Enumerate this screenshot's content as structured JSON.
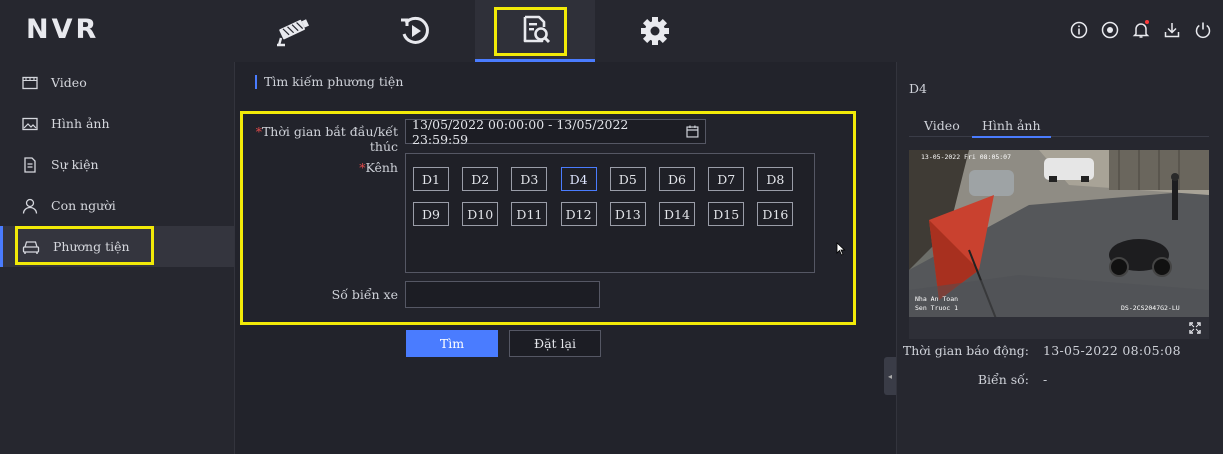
{
  "app": {
    "logo": "NVR"
  },
  "nav_tabs": [
    {
      "icon": "camera-icon"
    },
    {
      "icon": "playback-icon"
    },
    {
      "icon": "search-file-icon",
      "active": true
    },
    {
      "icon": "gear-icon"
    }
  ],
  "top_right_icons": [
    "info-icon",
    "record-icon",
    "bell-icon",
    "download-icon",
    "power-icon"
  ],
  "sidebar": {
    "items": [
      {
        "label": "Video",
        "icon": "video-icon"
      },
      {
        "label": "Hình ảnh",
        "icon": "image-icon"
      },
      {
        "label": "Sự kiện",
        "icon": "event-icon"
      },
      {
        "label": "Con người",
        "icon": "person-icon"
      },
      {
        "label": "Phương tiện",
        "icon": "car-icon",
        "active": true
      }
    ]
  },
  "main": {
    "breadcrumb": "Tìm kiếm phương tiện",
    "time_label": "Thời gian bắt đầu/kết thúc",
    "time_value": "13/05/2022 00:00:00 - 13/05/2022 23:59:59",
    "channel_label": "Kênh",
    "channels": [
      "D1",
      "D2",
      "D3",
      "D4",
      "D5",
      "D6",
      "D7",
      "D8",
      "D9",
      "D10",
      "D11",
      "D12",
      "D13",
      "D14",
      "D15",
      "D16"
    ],
    "selected_channel": "D4",
    "plate_label": "Số biển xe",
    "plate_value": "",
    "search_button": "Tìm",
    "reset_button": "Đặt lại"
  },
  "right_panel": {
    "channel": "D4",
    "tabs": [
      "Video",
      "Hình ảnh"
    ],
    "active_tab": "Hình ảnh",
    "snapshot": {
      "timestamp_overlay": "13-05-2022 Fri 08:05:07",
      "overlay_line1": "Nha An Toan",
      "overlay_line2": "Sen Truoc 1",
      "camera_model": "DS-2CS2047G2-LU"
    },
    "alarm_time_label": "Thời gian báo động:",
    "alarm_time_value": "13-05-2022 08:05:08",
    "plate_label": "Biển số:",
    "plate_value": "-"
  },
  "colors": {
    "accent": "#4a7cff",
    "highlight": "#f2ea08",
    "required": "#e04a4a"
  }
}
